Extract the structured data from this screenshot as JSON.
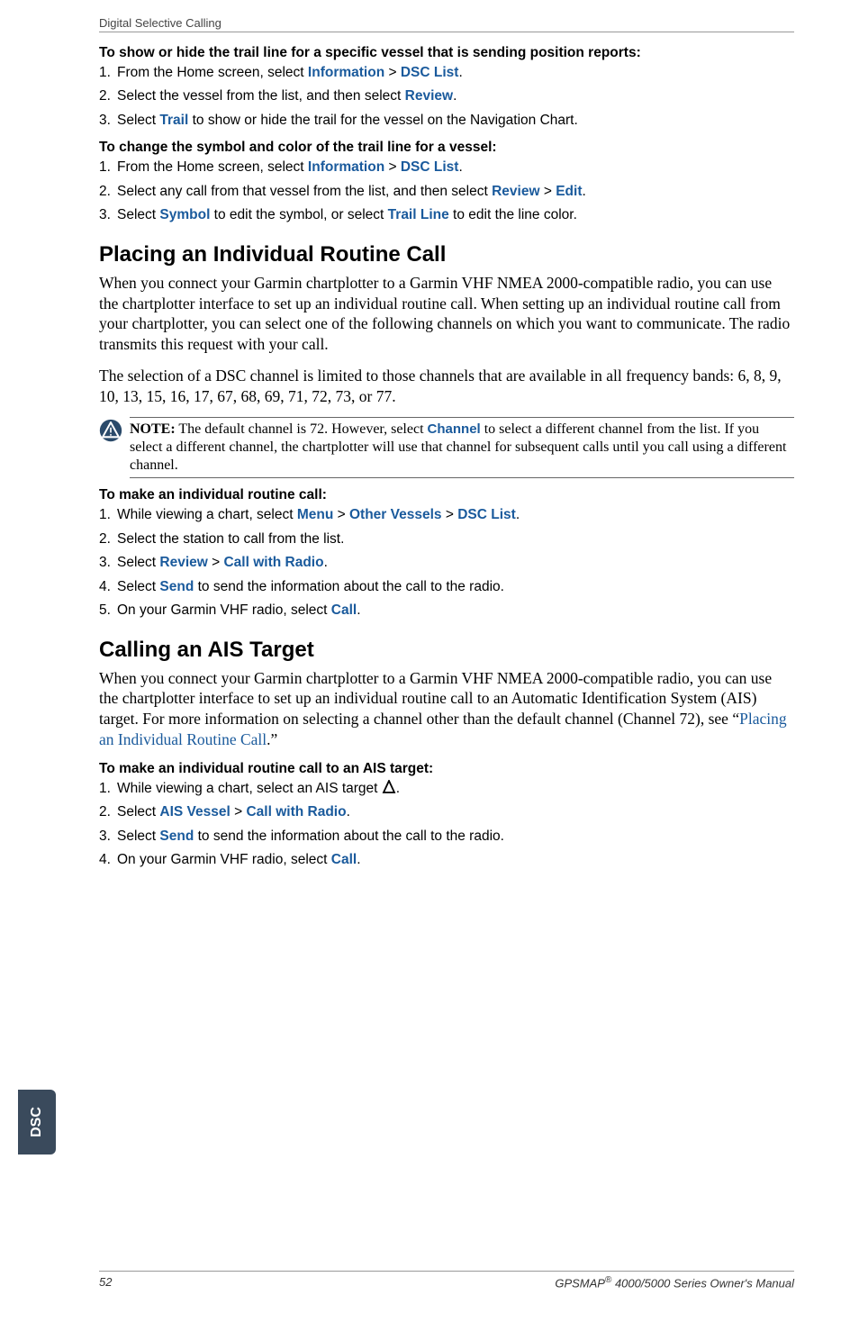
{
  "runningHead": "Digital Selective Calling",
  "sec1": {
    "head": "To show or hide the trail line for a specific vessel that is sending position reports:",
    "s1a": "From the Home screen, select ",
    "s1b": "Information",
    "s1c": " > ",
    "s1d": "DSC List",
    "s1e": ".",
    "s2a": "Select the vessel from the list, and then select ",
    "s2b": "Review",
    "s2c": ".",
    "s3a": "Select ",
    "s3b": "Trail",
    "s3c": " to show or hide the trail for the vessel on the Navigation Chart."
  },
  "sec2": {
    "head": "To change the symbol and color of the trail line for a vessel:",
    "s1a": "From the Home screen, select ",
    "s1b": "Information",
    "s1c": " > ",
    "s1d": "DSC List",
    "s1e": ".",
    "s2a": "Select any call from that vessel from the list, and then select ",
    "s2b": "Review",
    "s2c": " > ",
    "s2d": "Edit",
    "s2e": ".",
    "s3a": "Select ",
    "s3b": "Symbol",
    "s3c": " to edit the symbol, or select ",
    "s3d": "Trail Line",
    "s3e": " to edit the line color."
  },
  "h2a": "Placing an Individual Routine Call",
  "p1": "When you connect your Garmin chartplotter to a Garmin VHF NMEA 2000-compatible radio, you can use the chartplotter interface to set up an individual routine call. When setting up an individual routine call from your chartplotter, you can select one of the following channels on which you want to communicate. The radio transmits this request with your call.",
  "p2": "The selection of a DSC channel is limited to those channels that are available in all frequency bands: 6, 8, 9, 10, 13, 15, 16, 17, 67, 68, 69, 71, 72, 73, or 77.",
  "note": {
    "label": "NOTE:",
    "t1": " The default channel is 72. However, select ",
    "t2": "Channel",
    "t3": " to select a different channel from the list. If you select a different channel, the chartplotter will use that channel for subsequent calls until you call using a different channel."
  },
  "sec3": {
    "head": "To make an individual routine call:",
    "s1a": "While viewing a chart, select ",
    "s1b": "Menu",
    "s1c": " > ",
    "s1d": "Other Vessels",
    "s1e": " > ",
    "s1f": "DSC List",
    "s1g": ".",
    "s2": "Select the station to call from the list.",
    "s3a": "Select ",
    "s3b": "Review",
    "s3c": " > ",
    "s3d": "Call with Radio",
    "s3e": ".",
    "s4a": "Select ",
    "s4b": "Send",
    "s4c": " to send the information about the call to the radio.",
    "s5a": "On your Garmin VHF radio, select ",
    "s5b": "Call",
    "s5c": "."
  },
  "h2b": "Calling an AIS Target",
  "p3a": "When you connect your Garmin chartplotter to a Garmin VHF NMEA 2000-compatible radio, you can use the chartplotter interface to set up an individual routine call to an Automatic Identification System (AIS) target. For more information on selecting a channel other than the default channel (Channel 72), see “",
  "p3link": "Placing an Individual Routine Call",
  "p3b": ".”",
  "sec4": {
    "head": "To make an individual routine call to an AIS target:",
    "s1a": "While viewing a chart, select an AIS target ",
    "s1b": ".",
    "s2a": "Select ",
    "s2b": "AIS Vessel",
    "s2c": " > ",
    "s2d": "Call with Radio",
    "s2e": ".",
    "s3a": "Select ",
    "s3b": "Send",
    "s3c": " to send the information about the call to the radio.",
    "s4a": "On your Garmin VHF radio, select ",
    "s4b": "Call",
    "s4c": "."
  },
  "tab": "DSC",
  "footer": {
    "page": "52",
    "titleA": "GPSMAP",
    "titleB": " 4000/5000 Series Owner's Manual"
  }
}
